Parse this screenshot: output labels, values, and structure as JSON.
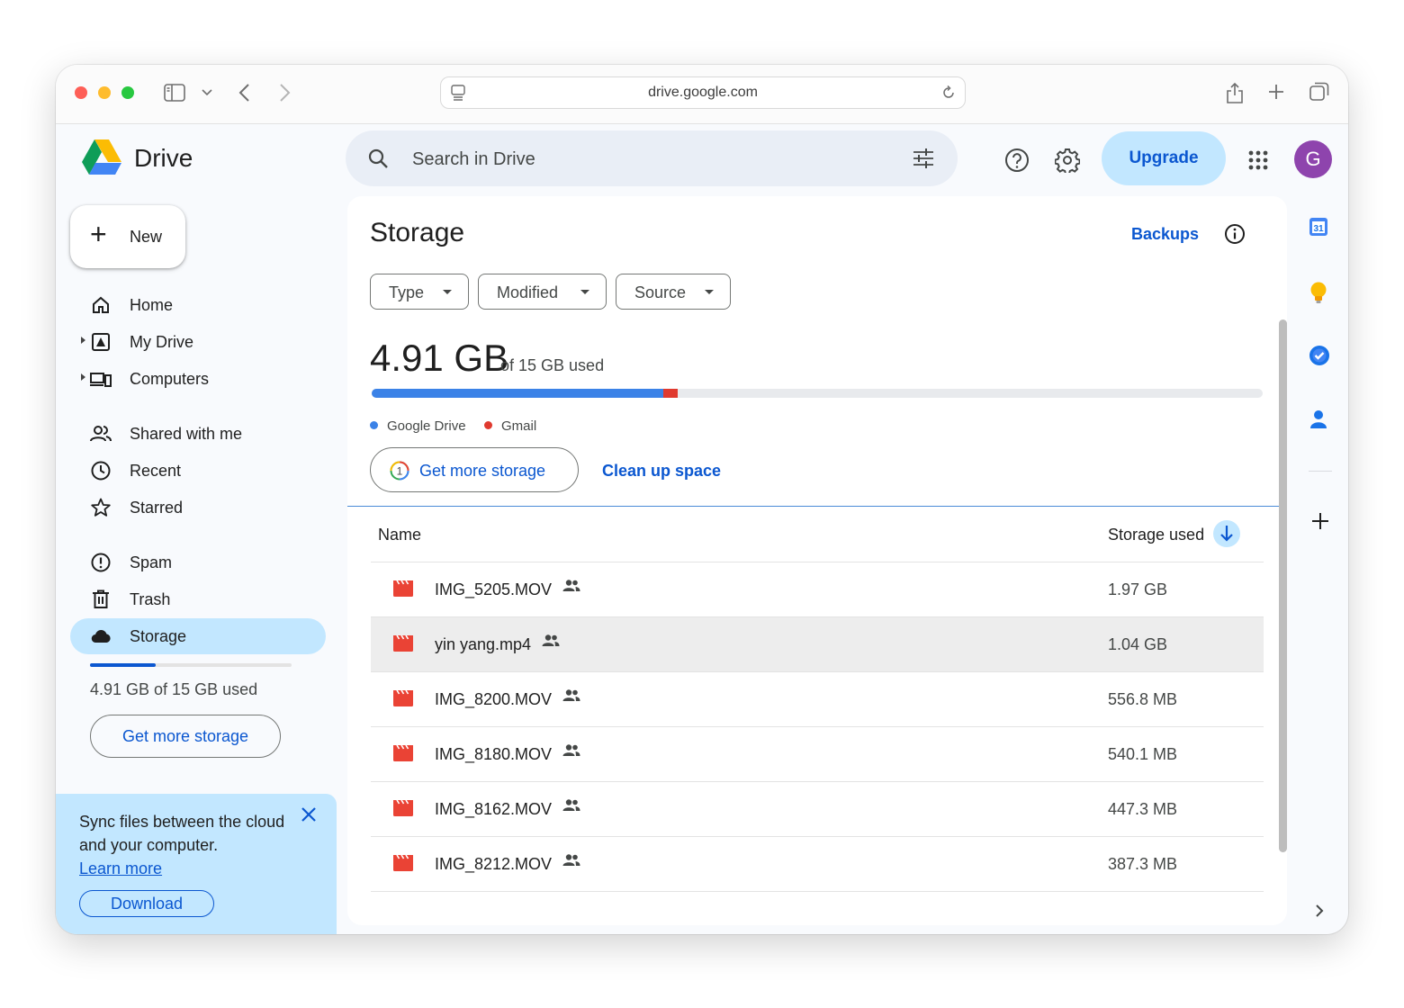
{
  "browser": {
    "url": "drive.google.com"
  },
  "app": {
    "name": "Drive",
    "search_placeholder": "Search in Drive",
    "upgrade_label": "Upgrade",
    "avatar_initial": "G"
  },
  "sidebar": {
    "new_label": "New",
    "items": [
      {
        "label": "Home",
        "icon": "home-icon"
      },
      {
        "label": "My Drive",
        "icon": "my-drive-icon"
      },
      {
        "label": "Computers",
        "icon": "computers-icon"
      },
      {
        "label": "Shared with me",
        "icon": "shared-icon"
      },
      {
        "label": "Recent",
        "icon": "clock-icon"
      },
      {
        "label": "Starred",
        "icon": "star-icon"
      },
      {
        "label": "Spam",
        "icon": "spam-icon"
      },
      {
        "label": "Trash",
        "icon": "trash-icon"
      },
      {
        "label": "Storage",
        "icon": "cloud-icon"
      }
    ],
    "usage_fraction": 0.327,
    "usage_text": "4.91 GB of 15 GB used",
    "get_more_storage": "Get more storage",
    "promo": {
      "text": "Sync files between the cloud and your computer.",
      "link": "Learn more",
      "download": "Download"
    }
  },
  "main": {
    "title": "Storage",
    "backups": "Backups",
    "filters": [
      "Type",
      "Modified",
      "Source"
    ],
    "used_amount": "4.91 GB",
    "used_of": "of 15 GB used",
    "usage": {
      "drive_fraction": 0.327,
      "gmail_fraction": 0.016
    },
    "legend": [
      {
        "label": "Google Drive",
        "color": "#3b82e7"
      },
      {
        "label": "Gmail",
        "color": "#e03a2f"
      }
    ],
    "get_more_storage": "Get more storage",
    "clean_up": "Clean up space",
    "columns": {
      "name": "Name",
      "storage": "Storage used"
    },
    "files": [
      {
        "name": "IMG_5205.MOV",
        "size": "1.97 GB"
      },
      {
        "name": "yin yang.mp4",
        "size": "1.04 GB"
      },
      {
        "name": "IMG_8200.MOV",
        "size": "556.8 MB"
      },
      {
        "name": "IMG_8180.MOV",
        "size": "540.1 MB"
      },
      {
        "name": "IMG_8162.MOV",
        "size": "447.3 MB"
      },
      {
        "name": "IMG_8212.MOV",
        "size": "387.3 MB"
      }
    ],
    "selected_row": 1
  },
  "right_panel": {
    "calendar_day": "31"
  }
}
